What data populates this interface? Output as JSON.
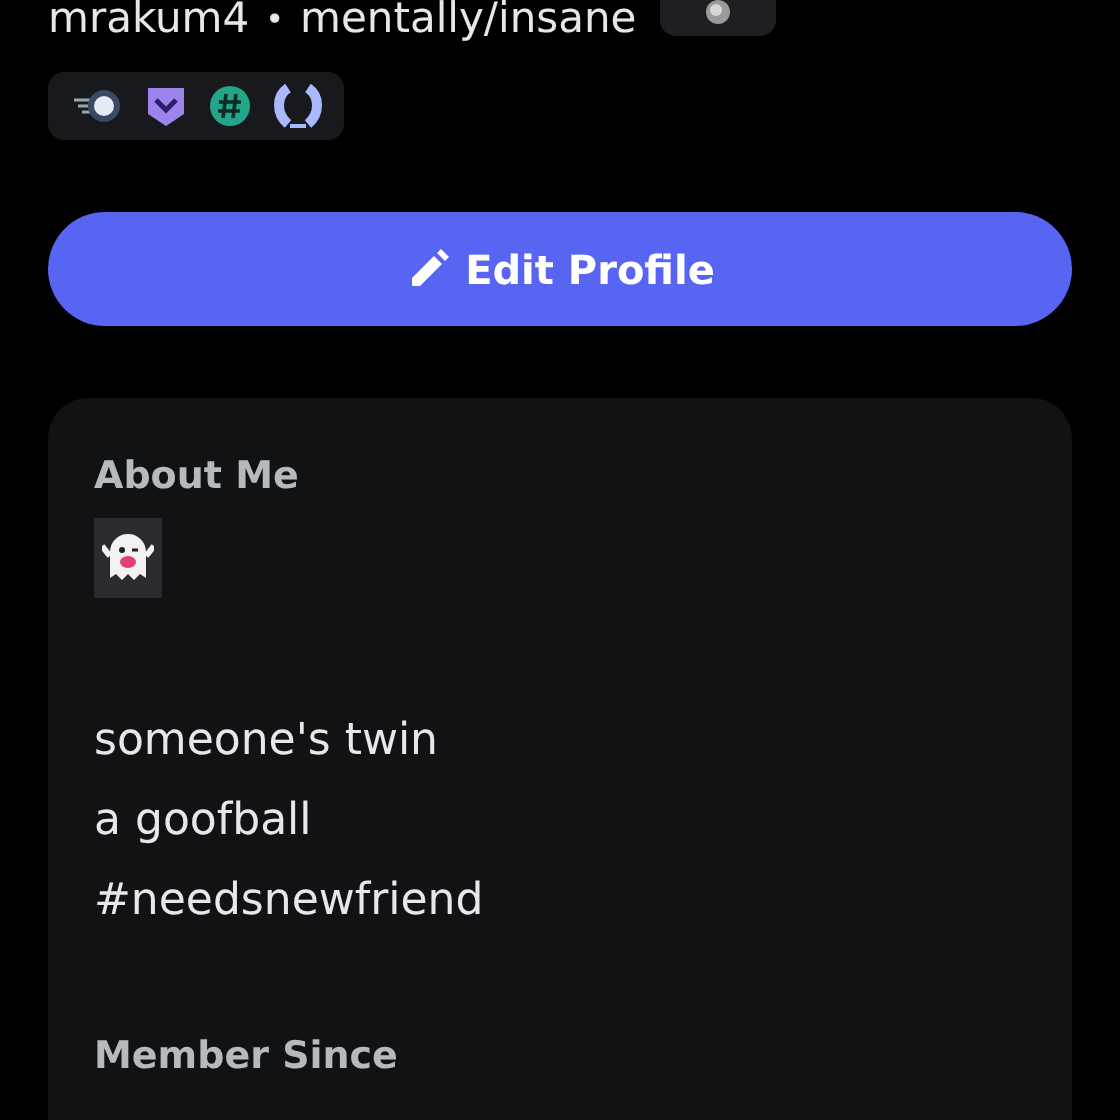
{
  "profile": {
    "username": "mrakum4",
    "separator": "•",
    "pronouns": "mentally/insane"
  },
  "badges": [
    {
      "kind": "speed"
    },
    {
      "kind": "shield"
    },
    {
      "kind": "hash"
    },
    {
      "kind": "laurel"
    }
  ],
  "edit_button": {
    "label": "Edit Profile"
  },
  "about": {
    "heading": "About Me",
    "lines": [
      "someone's twin",
      "a goofball",
      "#needsnewfriend"
    ]
  },
  "member_since": {
    "heading": "Member Since"
  }
}
